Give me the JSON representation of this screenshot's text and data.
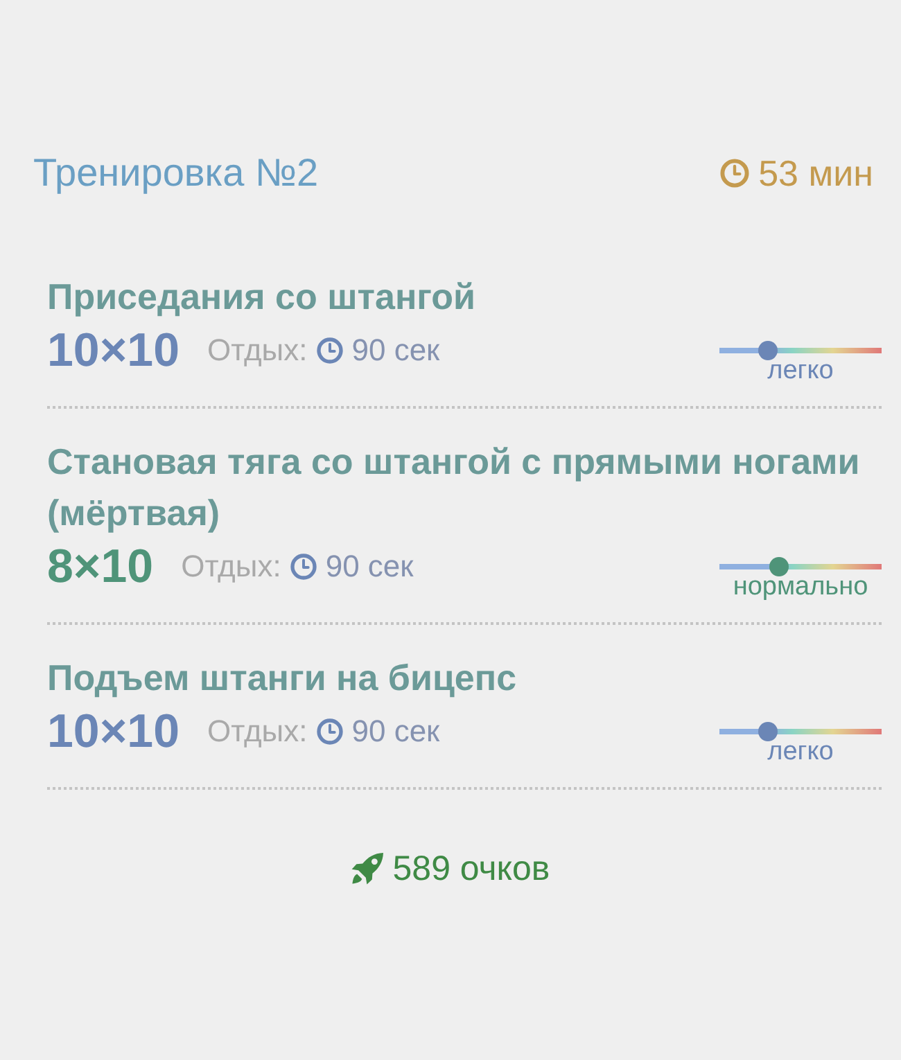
{
  "header": {
    "title": "Тренировка №2",
    "duration": "53 мин"
  },
  "exercises": [
    {
      "name": "Приседания со штангой",
      "sets": "10×10",
      "rest_label": "Отдых:",
      "rest_time": "90 сек",
      "level": 0.3,
      "difficulty": "легко",
      "color": "#6b86b6"
    },
    {
      "name": "Становая тяга со штангой с прямыми ногами (мёртвая)",
      "sets": "8×10",
      "rest_label": "Отдых:",
      "rest_time": "90 сек",
      "level": 0.37,
      "difficulty": "нормально",
      "color": "#4f9479"
    },
    {
      "name": "Подъем штанги на бицепс",
      "sets": "10×10",
      "rest_label": "Отдых:",
      "rest_time": "90 сек",
      "level": 0.3,
      "difficulty": "легко",
      "color": "#6b86b6"
    }
  ],
  "footer": {
    "points": "589 очков"
  }
}
